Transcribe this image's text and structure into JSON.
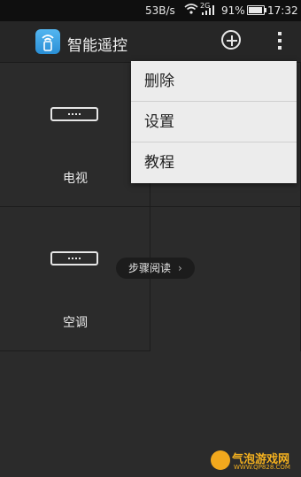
{
  "status_bar": {
    "speed": "53B/s",
    "network_type": "2G",
    "battery_percent": "91%",
    "battery_level": 0.91,
    "time": "17:32"
  },
  "app_bar": {
    "title": "智能遥控",
    "add_icon": "plus-circle-icon",
    "more_icon": "overflow-menu-icon"
  },
  "devices": [
    {
      "label": "电视",
      "icon": "set-top-box-icon"
    },
    {
      "label": "空调",
      "icon": "set-top-box-icon"
    }
  ],
  "tutorial_pill": {
    "label": "步骤阅读",
    "chevron": "›"
  },
  "menu": {
    "items": [
      {
        "label": "删除"
      },
      {
        "label": "设置"
      },
      {
        "label": "教程"
      }
    ]
  },
  "watermark": {
    "name": "气泡游戏网",
    "url": "WWW.QP828.COM"
  }
}
